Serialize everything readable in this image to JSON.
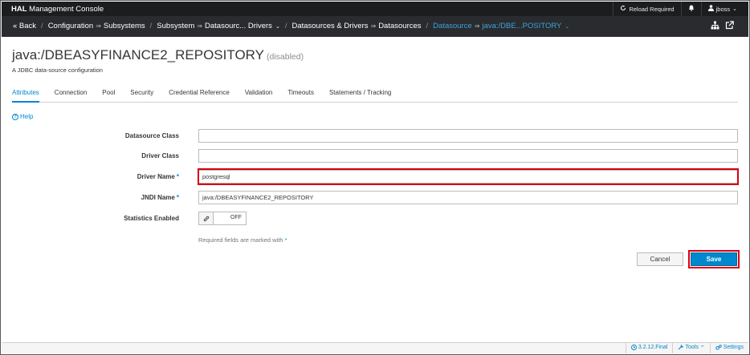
{
  "app": {
    "brand_bold": "HAL",
    "brand_rest": " Management Console"
  },
  "topbar": {
    "reload_label": "Reload Required",
    "bell_glyph": "🔔",
    "user_label": "jboss",
    "reload_icon": "reload-icon",
    "user_icon": "user-icon"
  },
  "breadcrumb": {
    "back": "« Back",
    "items": [
      {
        "a": "Configuration",
        "b": "Subsystems"
      },
      {
        "a": "Subsystem",
        "b": "Datasourc... Drivers"
      },
      {
        "a": "Datasources & Drivers",
        "b": "Datasources"
      },
      {
        "a": "Datasource",
        "b": "java:/DBE...POSITORY"
      }
    ],
    "arrow": "⇒",
    "chevron": "⌄"
  },
  "page": {
    "title": "java:/DBEASYFINANCE2_REPOSITORY",
    "status": "(disabled)",
    "description": "A JDBC data-source configuration"
  },
  "tabs": [
    {
      "label": "Attributes",
      "active": true
    },
    {
      "label": "Connection"
    },
    {
      "label": "Pool"
    },
    {
      "label": "Security"
    },
    {
      "label": "Credential Reference"
    },
    {
      "label": "Validation"
    },
    {
      "label": "Timeouts"
    },
    {
      "label": "Statements / Tracking"
    }
  ],
  "help_label": "Help",
  "form": {
    "datasource_class": {
      "label": "Datasource Class",
      "value": ""
    },
    "driver_class": {
      "label": "Driver Class",
      "value": ""
    },
    "driver_name": {
      "label": "Driver Name",
      "value": "postgresql"
    },
    "jndi_name": {
      "label": "JNDI Name",
      "value": "java:/DBEASYFINANCE2_REPOSITORY"
    },
    "statistics_enabled": {
      "label": "Statistics Enabled",
      "state": "OFF"
    },
    "required_star": "*",
    "required_note": "Required fields are marked with"
  },
  "buttons": {
    "cancel": "Cancel",
    "save": "Save"
  },
  "footer": {
    "version": "3.2.12.Final",
    "tools": "Tools",
    "settings": "Settings"
  },
  "colors": {
    "accent": "#0088ce",
    "highlight": "#d9000f",
    "nav_dark": "#292b2e"
  }
}
